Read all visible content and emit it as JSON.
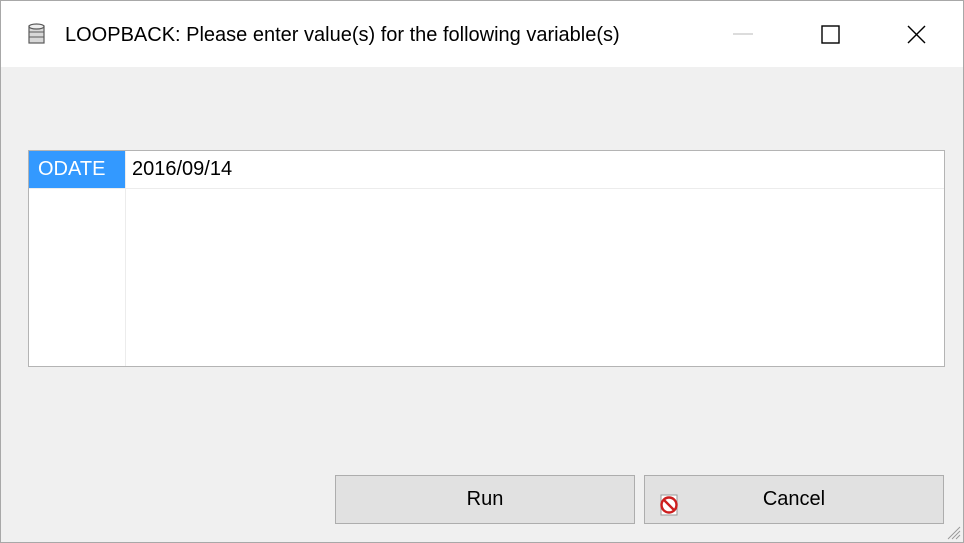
{
  "window": {
    "title": "LOOPBACK: Please enter value(s) for the following variable(s)",
    "title_icon": "database-icon",
    "controls": {
      "minimize_icon": "minimize-icon",
      "maximize_icon": "maximize-icon",
      "close_icon": "close-icon"
    }
  },
  "variables": [
    {
      "name": "ODATE",
      "value": "2016/09/14"
    }
  ],
  "buttons": {
    "run_label": "Run",
    "cancel_label": "Cancel",
    "cancel_icon": "cancel-icon"
  },
  "colors": {
    "selection": "#3399ff",
    "window_bg": "#f0f0f0",
    "button_bg": "#e1e1e1",
    "cancel_icon": "#cc1f1f"
  }
}
